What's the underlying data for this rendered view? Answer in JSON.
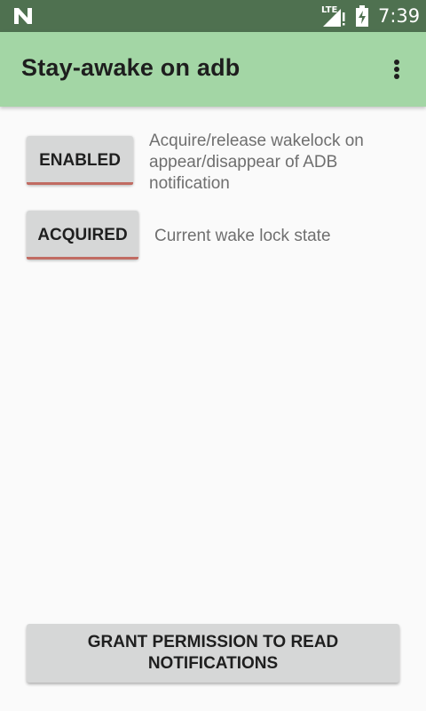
{
  "status_bar": {
    "network_type": "LTE",
    "time": "7:39",
    "colors": {
      "background": "#4f7150",
      "icons": "#ffffff"
    },
    "icons": [
      "android-n-icon",
      "signal-icon",
      "battery-charging-icon"
    ]
  },
  "app_bar": {
    "title": "Stay-awake on adb",
    "menu_icon": "more-vert-icon",
    "colors": {
      "background": "#a3d6a5",
      "title": "#1e1e1e"
    }
  },
  "controls": {
    "enabled_button": {
      "label": "ENABLED"
    },
    "enabled_description": "Acquire/release wakelock on appear/disappear of ADB notification",
    "acquired_button": {
      "label": "ACQUIRED"
    },
    "acquired_description": "Current wake lock state",
    "toggle_on_color": "#c16b62"
  },
  "footer": {
    "grant_button": {
      "line1": "GRANT PERMISSION TO READ",
      "line2": "NOTIFICATIONS"
    }
  }
}
